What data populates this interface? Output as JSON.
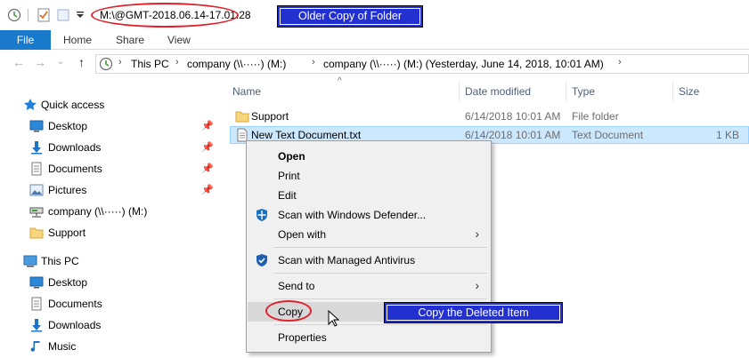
{
  "window": {
    "title": "M:\\@GMT-2018.06.14-17.01.28"
  },
  "callouts": {
    "older_copy": "Older Copy of Folder",
    "copy_deleted": "Copy the Deleted Item"
  },
  "ribbon": {
    "tabs": [
      "File",
      "Home",
      "Share",
      "View"
    ]
  },
  "address": {
    "crumbs": [
      "This PC",
      "company (\\\\·····) (M:)",
      "company (\\\\·····) (M:) (Yesterday, June 14, 2018, 10:01 AM)"
    ]
  },
  "sidebar": {
    "quick_access_label": "Quick access",
    "quick_items": [
      {
        "label": "Desktop",
        "icon": "desktop-icon"
      },
      {
        "label": "Downloads",
        "icon": "downloads-icon"
      },
      {
        "label": "Documents",
        "icon": "documents-icon"
      },
      {
        "label": "Pictures",
        "icon": "pictures-icon"
      },
      {
        "label": "company (\\\\·····) (M:)",
        "icon": "network-drive-icon"
      },
      {
        "label": "Support",
        "icon": "folder-icon"
      }
    ],
    "this_pc_label": "This PC",
    "pc_items": [
      {
        "label": "Desktop",
        "icon": "desktop-icon"
      },
      {
        "label": "Documents",
        "icon": "documents-icon"
      },
      {
        "label": "Downloads",
        "icon": "downloads-icon"
      },
      {
        "label": "Music",
        "icon": "music-icon"
      }
    ]
  },
  "columns": {
    "name": "Name",
    "date": "Date modified",
    "type": "Type",
    "size": "Size"
  },
  "files": [
    {
      "name": "Support",
      "date": "6/14/2018 10:01 AM",
      "type": "File folder",
      "size": ""
    },
    {
      "name": "New Text Document.txt",
      "date": "6/14/2018 10:01 AM",
      "type": "Text Document",
      "size": "1 KB"
    }
  ],
  "context_menu": {
    "items": [
      {
        "label": "Open"
      },
      {
        "label": "Print"
      },
      {
        "label": "Edit"
      },
      {
        "label": "Scan with Windows Defender..."
      },
      {
        "label": "Open with"
      },
      {
        "label": "Scan with Managed Antivirus"
      },
      {
        "label": "Send to"
      },
      {
        "label": "Copy"
      },
      {
        "label": "Properties"
      }
    ]
  },
  "colors": {
    "accent": "#1979ca",
    "callout": "#2330d0",
    "annotation": "#e0202a",
    "selection": "#cce8ff"
  }
}
